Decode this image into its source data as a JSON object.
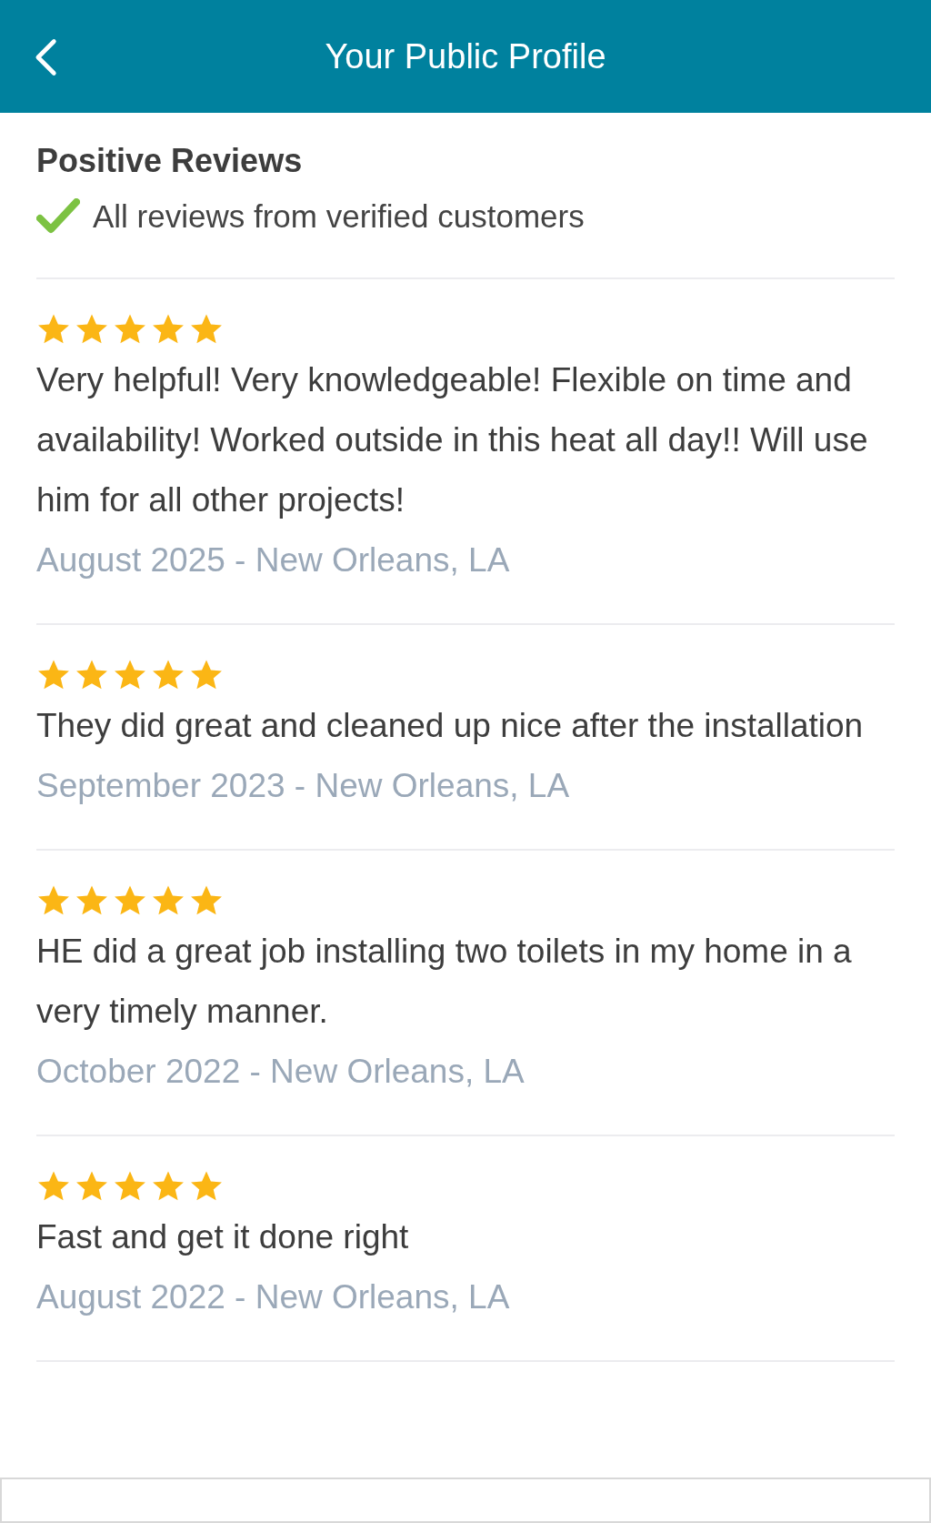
{
  "header": {
    "title": "Your Public Profile"
  },
  "section": {
    "title": "Positive Reviews",
    "note": "All reviews from verified customers"
  },
  "reviews": [
    {
      "stars": 5,
      "text": "Very helpful! Very knowledgeable! Flexible on time and availability! Worked outside in this heat all day!! Will use him for all other projects!",
      "meta": "August 2025 - New Orleans, LA"
    },
    {
      "stars": 5,
      "text": "They did great and cleaned up nice after the installation",
      "meta": "September 2023 - New Orleans, LA"
    },
    {
      "stars": 5,
      "text": "HE did a great job installing two toilets in my home in a very timely manner.",
      "meta": "October 2022 - New Orleans, LA"
    },
    {
      "stars": 5,
      "text": "Fast and get it done right",
      "meta": "August 2022 - New Orleans, LA"
    }
  ]
}
